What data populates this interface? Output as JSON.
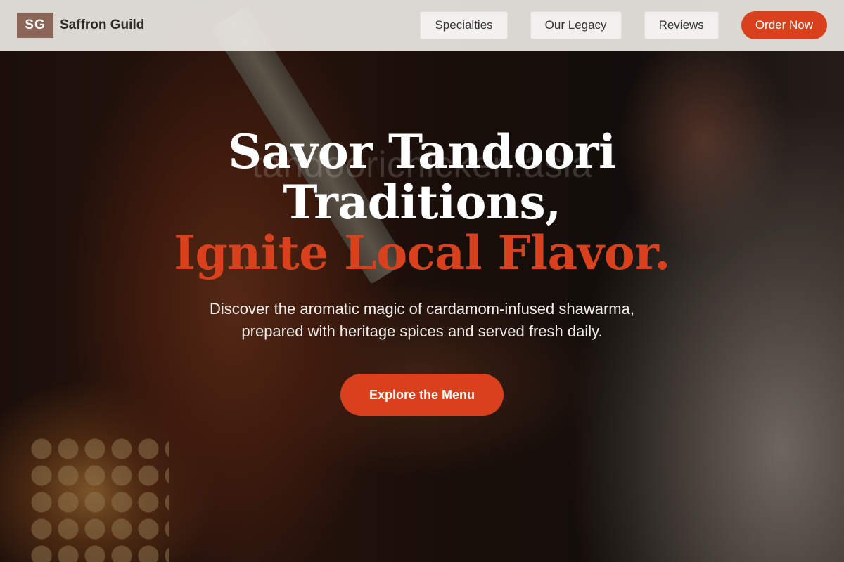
{
  "navbar": {
    "logo_initials": "SG",
    "brand_name": "Saffron Guild",
    "links": [
      "Specialties",
      "Our Legacy",
      "Reviews"
    ],
    "order_button": "Order Now"
  },
  "hero": {
    "headline_line1": "Savor Tandoori",
    "headline_line2": "Traditions,",
    "headline_accent": "Ignite Local Flavor.",
    "watermark": "tandoorichicken.asia",
    "subtitle": "Discover the aromatic magic of cardamom-infused shawarma, prepared with heritage spices and served fresh daily.",
    "cta_label": "Explore the Menu"
  },
  "colors": {
    "accent": "#d9411c",
    "logo_bg": "#8a6558",
    "navbar_bg": "#ece8e4"
  }
}
